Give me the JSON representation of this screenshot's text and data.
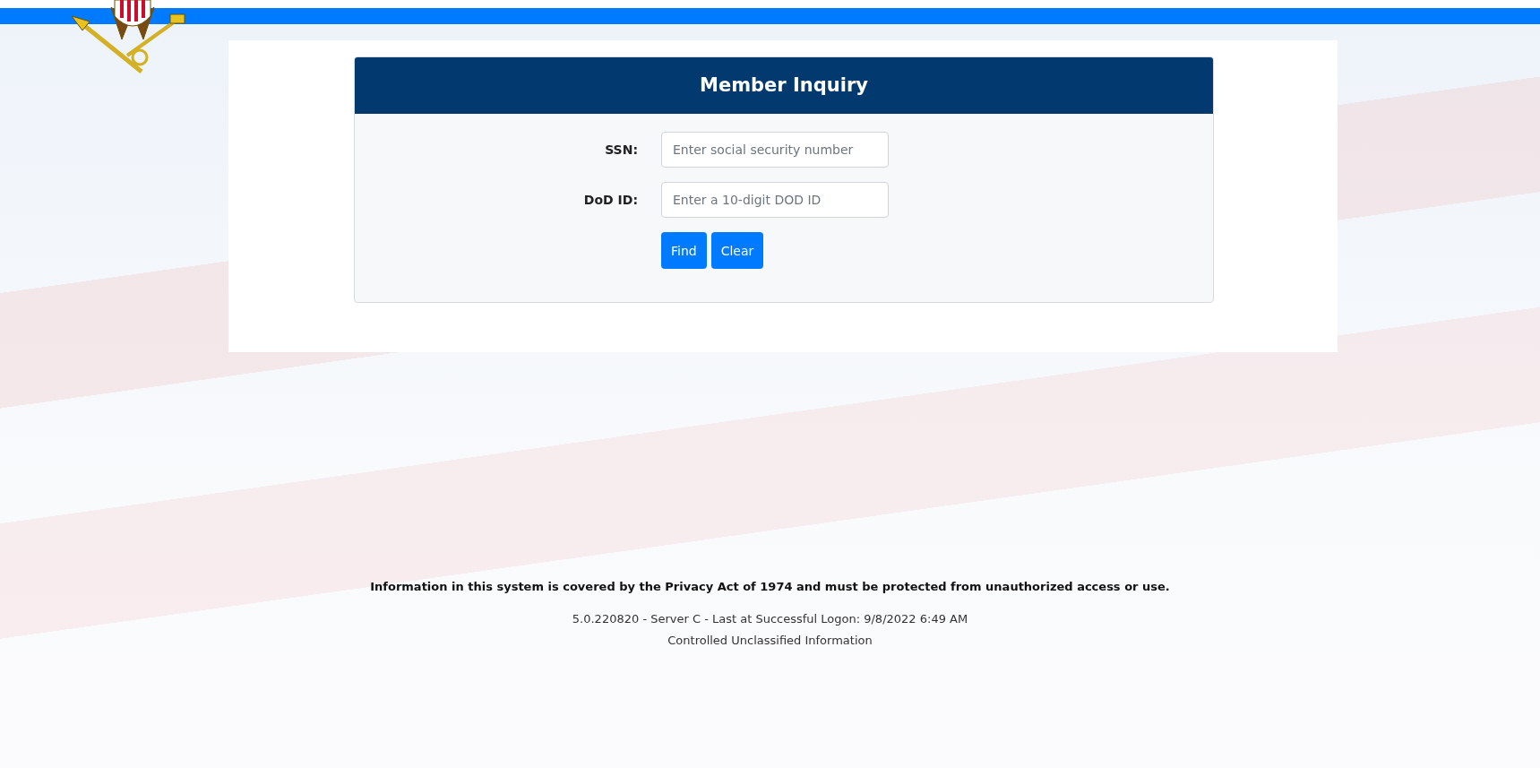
{
  "form": {
    "title": "Member Inquiry",
    "fields": [
      {
        "label": "SSN:",
        "placeholder": "Enter social security number"
      },
      {
        "label": "DoD ID:",
        "placeholder": "Enter a 10-digit DOD ID"
      }
    ],
    "buttons": [
      "Find",
      "Clear"
    ]
  },
  "footer": {
    "notice": "Information in this system is covered by the Privacy Act of 1974 and must be protected from unauthorized access or use.",
    "lines": [
      "5.0.220820 - Server C - Last at Successful Logon: 9/8/2022 6:49 AM",
      "Controlled Unclassified Information"
    ]
  }
}
